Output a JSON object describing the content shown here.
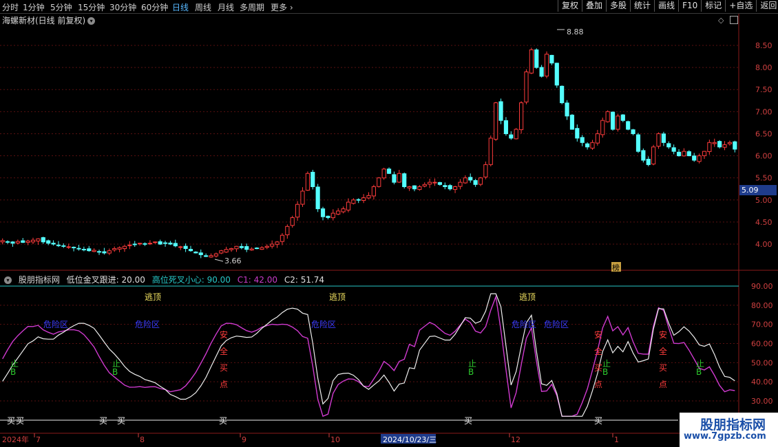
{
  "toolbar": {
    "periods": [
      "分时",
      "1分钟",
      "5分钟",
      "15分钟",
      "30分钟",
      "60分钟",
      "日线",
      "周线",
      "月线",
      "多周期",
      "更多"
    ],
    "active": "日线",
    "right_buttons": [
      "复权",
      "叠加",
      "多股",
      "统计",
      "画线",
      "F10",
      "标记",
      "+自选",
      "返回"
    ]
  },
  "stock": {
    "title": "海螺新材(日线 前复权)",
    "high_label": "8.88",
    "low_label": "3.66",
    "current_price": "5.09",
    "bang_label": "榜"
  },
  "price_axis": [
    "8.50",
    "8.00",
    "7.50",
    "7.00",
    "6.50",
    "6.00",
    "5.50",
    "5.00",
    "4.50",
    "4.00"
  ],
  "indicator": {
    "name": "股朋指标网",
    "low_cross": "低位金叉跟进: 20.00",
    "high_cross": "高位死叉小心: 90.00",
    "c1": "C1: 42.00",
    "c2": "C2: 51.74",
    "axis": [
      "90.00",
      "80.00",
      "70.00",
      "60.00",
      "50.00",
      "40.00",
      "30.00"
    ],
    "labels": {
      "escape": "逃顶",
      "danger": "危险区",
      "buy": "买",
      "stop": "止",
      "stop2": "B",
      "safe": [
        "安",
        "全",
        "买",
        "点"
      ]
    }
  },
  "date_axis": {
    "year": "2024年",
    "months": [
      "7",
      "8",
      "9",
      "10",
      "12",
      "1"
    ],
    "highlight": "2024/10/23/三"
  },
  "watermark": {
    "line1": "股朋指标网",
    "line2": "www.7gpzb.com"
  },
  "chart_data": {
    "type": "candlestick",
    "price_axis_range": [
      3.6,
      8.9
    ],
    "closes": [
      4.08,
      4.05,
      4.02,
      4.06,
      4.04,
      4.07,
      4.09,
      4.12,
      4.05,
      4.02,
      4.0,
      3.98,
      3.95,
      3.94,
      3.92,
      3.9,
      3.88,
      3.85,
      3.86,
      3.82,
      3.8,
      3.85,
      3.9,
      3.92,
      3.95,
      3.98,
      4.0,
      4.02,
      4.0,
      4.02,
      4.05,
      4.0,
      4.02,
      4.0,
      3.96,
      3.94,
      3.9,
      3.85,
      3.8,
      3.76,
      3.72,
      3.74,
      3.78,
      3.85,
      3.88,
      3.9,
      3.95,
      3.92,
      3.88,
      3.89,
      3.9,
      3.92,
      3.95,
      4.0,
      4.05,
      4.2,
      4.4,
      4.6,
      4.9,
      5.2,
      5.6,
      5.3,
      4.8,
      4.62,
      4.6,
      4.7,
      4.75,
      4.8,
      4.95,
      5.0,
      5.0,
      5.05,
      5.1,
      5.3,
      5.5,
      5.7,
      5.6,
      5.4,
      5.6,
      5.3,
      5.3,
      5.25,
      5.3,
      5.35,
      5.4,
      5.4,
      5.35,
      5.3,
      5.25,
      5.3,
      5.4,
      5.5,
      5.45,
      5.35,
      5.5,
      5.8,
      6.4,
      7.2,
      6.8,
      6.5,
      6.4,
      6.6,
      7.2,
      7.9,
      8.4,
      8.0,
      7.8,
      8.3,
      8.1,
      7.6,
      7.2,
      6.9,
      6.6,
      6.4,
      6.3,
      6.2,
      6.3,
      6.5,
      6.8,
      7.0,
      6.6,
      6.9,
      6.8,
      6.6,
      6.5,
      6.1,
      5.9,
      5.8,
      6.2,
      6.5,
      6.3,
      6.2,
      6.1,
      6.0,
      6.1,
      6.0,
      5.9,
      6.0,
      6.1,
      6.3,
      6.3,
      6.2,
      6.25,
      6.3,
      6.15
    ]
  }
}
